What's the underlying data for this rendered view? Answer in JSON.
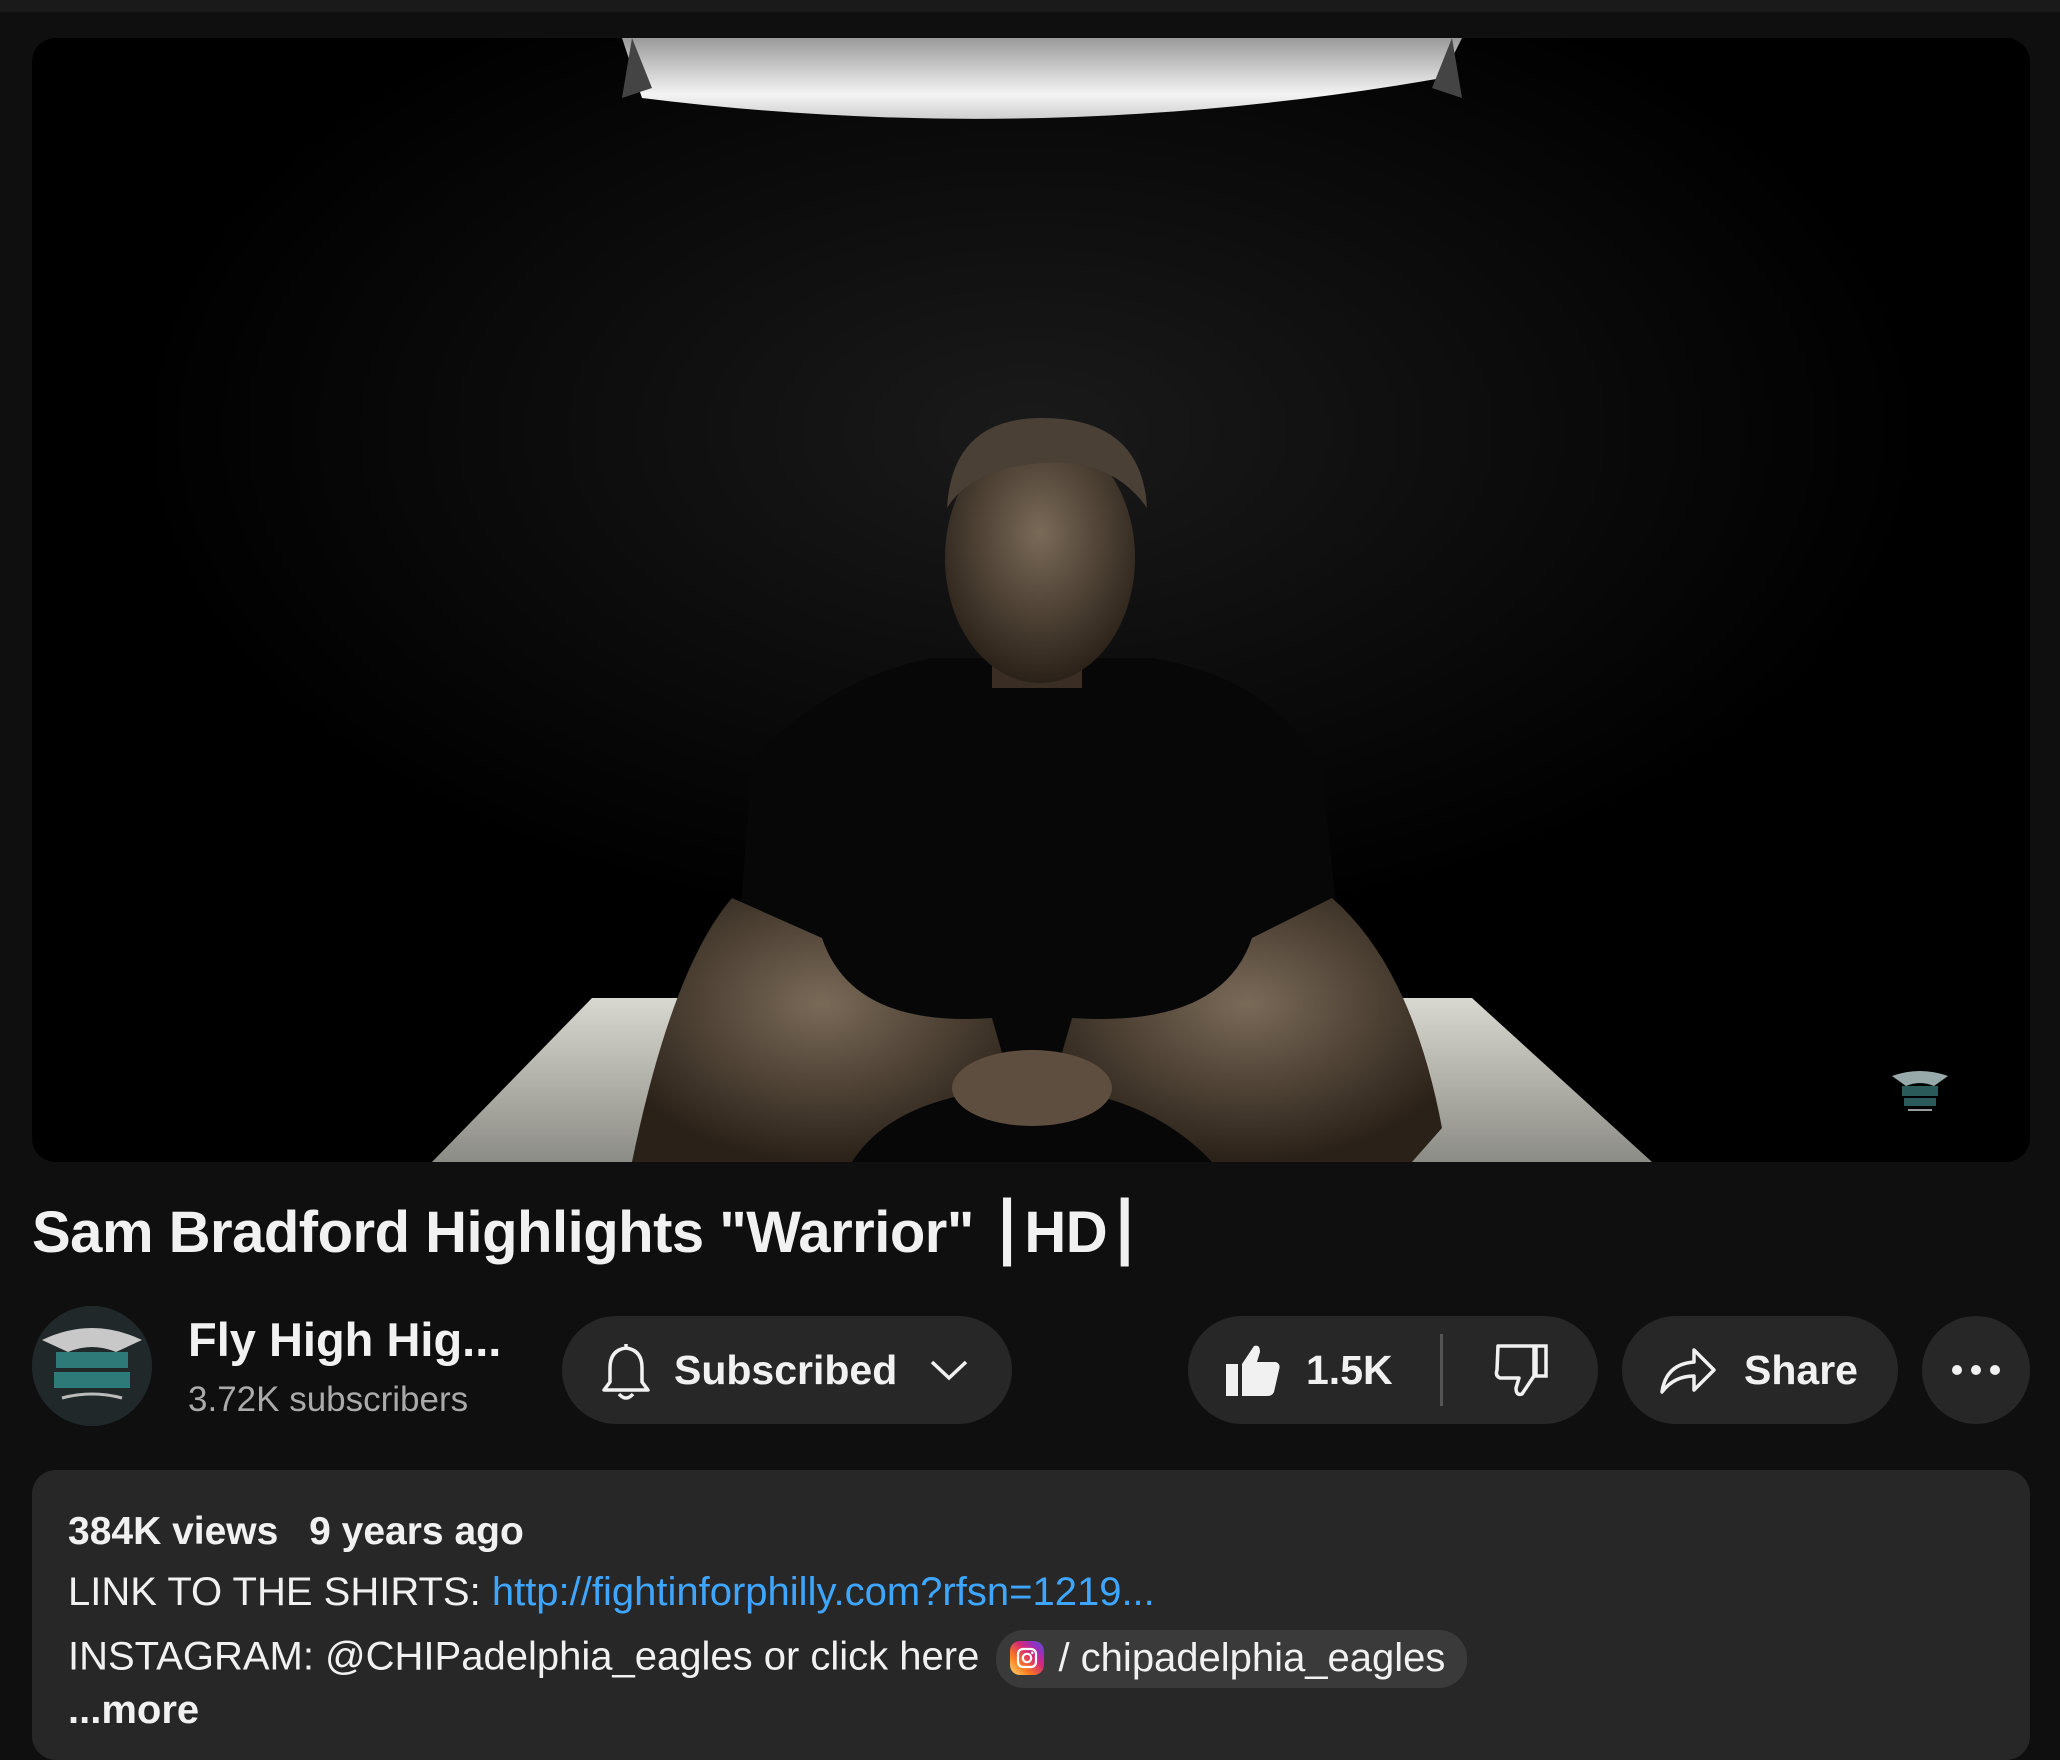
{
  "video": {
    "title": "Sam Bradford Highlights \"Warrior\" ⎮HD⎮"
  },
  "channel": {
    "name": "Fly High Hig...",
    "subscribers": "3.72K subscribers"
  },
  "actions": {
    "subscribe_label": "Subscribed",
    "like_count": "1.5K",
    "share_label": "Share"
  },
  "description": {
    "views": "384K views",
    "age": "9 years ago",
    "line1_prefix": "LINK TO THE SHIRTS: ",
    "line1_link": "http://fightinforphilly.com?rfsn=1219...",
    "line2_prefix": "INSTAGRAM: @CHIPadelphia_eagles or click here ",
    "line2_chip": "/ chipadelphia_eagles",
    "more": "...more"
  },
  "colors": {
    "background": "#0f0f0f",
    "pill": "#272727",
    "link": "#3ea6ff"
  },
  "icons": [
    "bell-icon",
    "chevron-down-icon",
    "thumbs-up-icon",
    "thumbs-down-icon",
    "share-icon",
    "more-icon",
    "instagram-icon"
  ]
}
